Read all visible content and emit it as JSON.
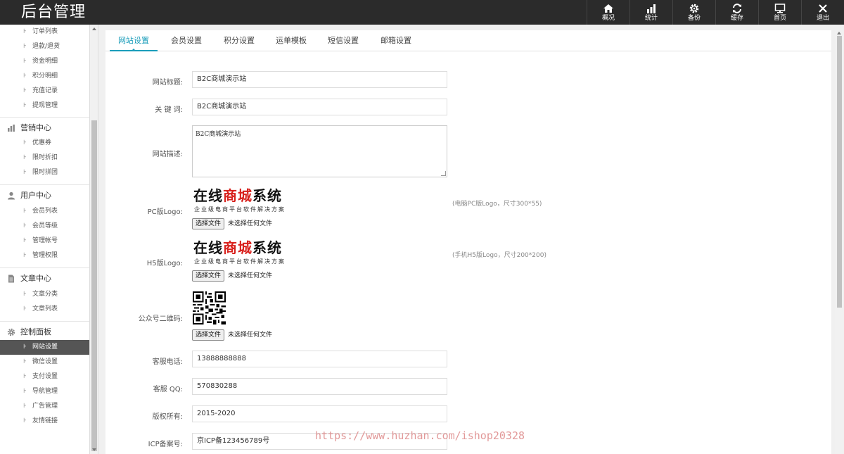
{
  "app": {
    "title": "后台管理"
  },
  "topnav": [
    {
      "label": "概况",
      "icon": "home-icon"
    },
    {
      "label": "统计",
      "icon": "bar-chart-icon"
    },
    {
      "label": "备份",
      "icon": "gear-icon"
    },
    {
      "label": "缓存",
      "icon": "refresh-icon"
    },
    {
      "label": "首页",
      "icon": "monitor-icon"
    },
    {
      "label": "退出",
      "icon": "close-icon"
    }
  ],
  "sidebar": {
    "items_top": [
      "订单列表",
      "退款/退货",
      "资金明细",
      "积分明细",
      "充值记录",
      "提现管理"
    ],
    "groups": [
      {
        "title": "营销中心",
        "icon": "chart-icon",
        "items": [
          "优惠券",
          "限时折扣",
          "限时拼团"
        ]
      },
      {
        "title": "用户中心",
        "icon": "user-icon",
        "items": [
          "会员列表",
          "会员等级",
          "管理帐号",
          "管理权限"
        ]
      },
      {
        "title": "文章中心",
        "icon": "document-icon",
        "items": [
          "文章分类",
          "文章列表"
        ]
      },
      {
        "title": "控制面板",
        "icon": "gear-icon",
        "items": [
          "网站设置",
          "微信设置",
          "支付设置",
          "导航管理",
          "广告管理",
          "友情链接"
        ]
      }
    ],
    "active_item": "网站设置"
  },
  "tabs": [
    "网站设置",
    "会员设置",
    "积分设置",
    "运单模板",
    "短信设置",
    "邮箱设置"
  ],
  "active_tab": "网站设置",
  "form": {
    "site_title": {
      "label": "网站标题:",
      "value": "B2C商城演示站"
    },
    "keywords": {
      "label": "关 键 词:",
      "value": "B2C商城演示站"
    },
    "description": {
      "label": "网站描述:",
      "value": "B2C商城演示站"
    },
    "pc_logo": {
      "label": "PC版Logo:",
      "hint": "(电脑PC版Logo，尺寸300*55)"
    },
    "h5_logo": {
      "label": "H5版Logo:",
      "hint": "(手机H5版Logo，尺寸200*200)"
    },
    "qrcode": {
      "label": "公众号二维码:"
    },
    "phone": {
      "label": "客服电话:",
      "value": "13888888888"
    },
    "qq": {
      "label": "客服 QQ:",
      "value": "570830288"
    },
    "copyright": {
      "label": "版权所有:",
      "value": "2015-2020"
    },
    "icp": {
      "label": "ICP备案号:",
      "value": "京ICP备123456789号"
    }
  },
  "logo_image": {
    "line1_a": "在线",
    "line1_b": "商城",
    "line1_c": "系统",
    "line2": "企业级电商平台软件解决方案"
  },
  "file_input": {
    "button": "选择文件",
    "status": "未选择任何文件"
  },
  "watermark": "https://www.huzhan.com/ishop20328",
  "colors": {
    "topbar": "#2b2b2b",
    "accent": "#1a9dba",
    "active_sidebar": "#555555",
    "logo_red": "#d8211d"
  }
}
